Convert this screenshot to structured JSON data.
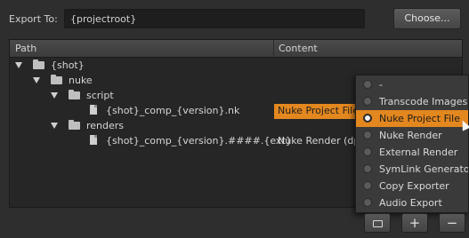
{
  "export": {
    "label": "Export To:",
    "value": "{projectroot}",
    "choose_label": "Choose..."
  },
  "tree": {
    "columns": [
      "Path",
      "Content"
    ],
    "rows": [
      {
        "label": "{shot}",
        "type": "folder",
        "content": ""
      },
      {
        "label": "nuke",
        "type": "folder",
        "content": ""
      },
      {
        "label": "script",
        "type": "folder",
        "content": ""
      },
      {
        "label": "{shot}_comp_{version}.nk",
        "type": "file",
        "content": "Nuke Project File"
      },
      {
        "label": "renders",
        "type": "folder",
        "content": ""
      },
      {
        "label": "{shot}_comp_{version}.####.{ext}",
        "type": "file",
        "content": "Nuke Render (dp"
      }
    ]
  },
  "menu": {
    "items": [
      {
        "label": "-",
        "selected": false
      },
      {
        "label": "Transcode Images",
        "selected": false
      },
      {
        "label": "Nuke Project File",
        "selected": true
      },
      {
        "label": "Nuke Render",
        "selected": false
      },
      {
        "label": "External Render",
        "selected": false
      },
      {
        "label": "SymLink Generator",
        "selected": false
      },
      {
        "label": "Copy Exporter",
        "selected": false
      },
      {
        "label": "Audio Export",
        "selected": false
      }
    ]
  },
  "buttons": {
    "add": "+",
    "remove": "−"
  },
  "colors": {
    "accent": "#e3871f",
    "background": "#2e2e2e"
  }
}
